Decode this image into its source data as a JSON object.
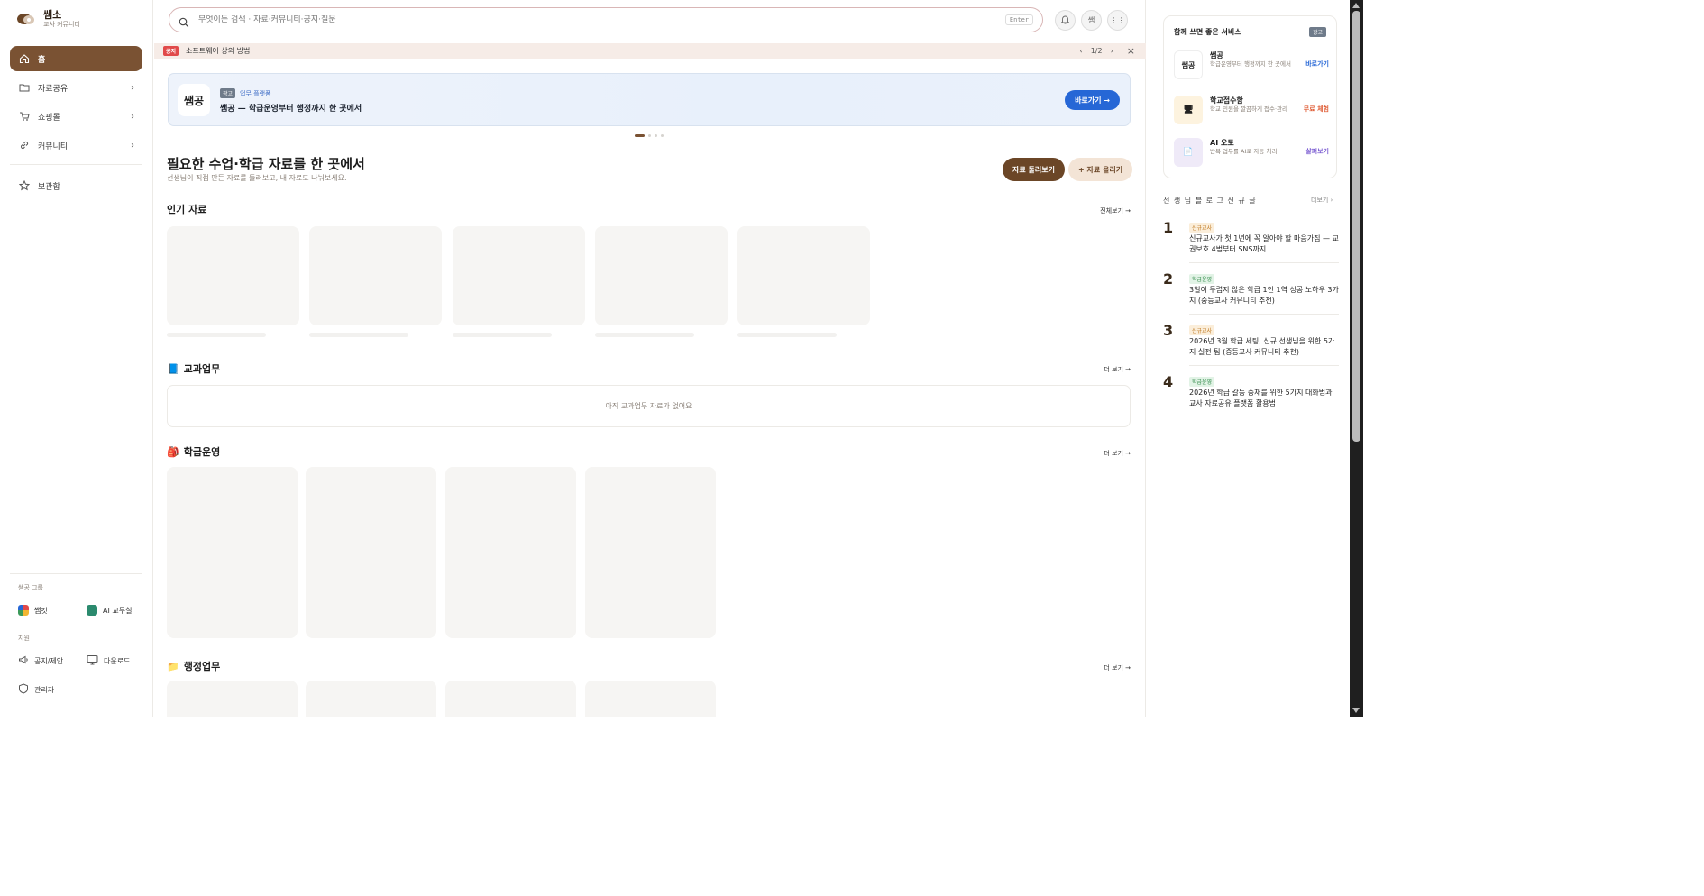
{
  "brand": {
    "name": "쌤소",
    "subtitle": "교사 커뮤니티"
  },
  "sidebar": {
    "items": [
      {
        "label": "홈",
        "icon": "home-icon",
        "active": true,
        "chevron": ""
      },
      {
        "label": "자료공유",
        "icon": "folder-icon",
        "active": false,
        "chevron": "›"
      },
      {
        "label": "쇼핑몰",
        "icon": "cart-icon",
        "active": false,
        "chevron": "›"
      },
      {
        "label": "커뮤니티",
        "icon": "link-icon",
        "active": false,
        "chevron": "›"
      },
      {
        "label": "보관함",
        "icon": "star-icon",
        "active": false,
        "chevron": ""
      }
    ],
    "group_label": "쌤공 그룹",
    "group_items": [
      {
        "label": "쌤킷"
      },
      {
        "label": "AI 교무실"
      }
    ],
    "support_label": "지원",
    "support_items": [
      {
        "label": "공지/제안"
      },
      {
        "label": "다운로드"
      }
    ],
    "admin_label": "관리자"
  },
  "search": {
    "placeholder": "무엇이든 검색 · 자료·커뮤니티·공지·질문",
    "kbd": "Enter"
  },
  "header": {
    "avatar_initial": "쌤",
    "apps_glyph": "⋮⋮"
  },
  "notice": {
    "badge": "공지",
    "text": "소프트웨어 상의 방법",
    "page": "1/2",
    "prev": "‹",
    "next": "›",
    "close": "×"
  },
  "banner": {
    "logo": "쌤공",
    "ad_badge": "광고",
    "tag": "업무 플랫폼",
    "title": "쌤공 — 학급운영부터 행정까지 한 곳에서",
    "button": "바로가기 →"
  },
  "hero": {
    "title": "필요한 수업·학급 자료를 한 곳에서",
    "subtitle": "선생님이 직접 만든 자료를 둘러보고, 내 자료도 나눠보세요.",
    "browse_button": "자료 둘러보기",
    "upload_button": "+ 자료 올리기"
  },
  "sections": {
    "popular": {
      "title": "인기 자료",
      "more": "전체보기 →"
    },
    "subject": {
      "icon": "📘",
      "title": "교과업무",
      "more": "더 보기 →",
      "empty": "아직 교과업무 자료가 없어요"
    },
    "class": {
      "icon": "🎒",
      "title": "학급운영",
      "more": "더 보기 →"
    },
    "admin": {
      "icon": "📁",
      "title": "행정업무",
      "more": "더 보기 →"
    }
  },
  "rail": {
    "services_title": "함께 쓰면 좋은 서비스",
    "services_ad": "광고",
    "services": [
      {
        "icon": "쌤공",
        "name": "쌤공",
        "desc": "학급운영부터 행정까지 한 곳에서",
        "action": "바로가기",
        "action_color": "#2667d6"
      },
      {
        "icon": "🖥",
        "name": "학교접수함",
        "desc": "학교 민원을 깔끔하게 접수·관리",
        "action": "무료 체험",
        "action_color": "#e0603a"
      },
      {
        "icon": "📄",
        "name": "AI 오토",
        "desc": "반복 업무를 AI로 자동 처리",
        "action": "살펴보기",
        "action_color": "#7a5bd1"
      }
    ],
    "rank_title": "선 생 님 블 로 그 신 규 글",
    "rank_more": "더보기 ›",
    "ranks": [
      {
        "num": "1",
        "tag": "신규교사",
        "tag_class": "a",
        "text": "신규교사가 첫 1년에 꼭 알아야 할 마음가짐 — 교권보호 4법부터 SNS까지"
      },
      {
        "num": "2",
        "tag": "학급운영",
        "tag_class": "b",
        "text": "3일이 두렵지 않은 학급 1인 1역 성공 노하우 3가지 (중등교사 커뮤니티 추천)"
      },
      {
        "num": "3",
        "tag": "신규교사",
        "tag_class": "a",
        "text": "2026년 3월 학급 세팅, 신규 선생님을 위한 5가지 실전 팁 (중등교사 커뮤니티 추천)"
      },
      {
        "num": "4",
        "tag": "학급운영",
        "tag_class": "b",
        "text": "2026년 학급 갈등 중재를 위한 5가지 대화법과 교사 자료공유 플랫폼 활용법"
      }
    ]
  }
}
